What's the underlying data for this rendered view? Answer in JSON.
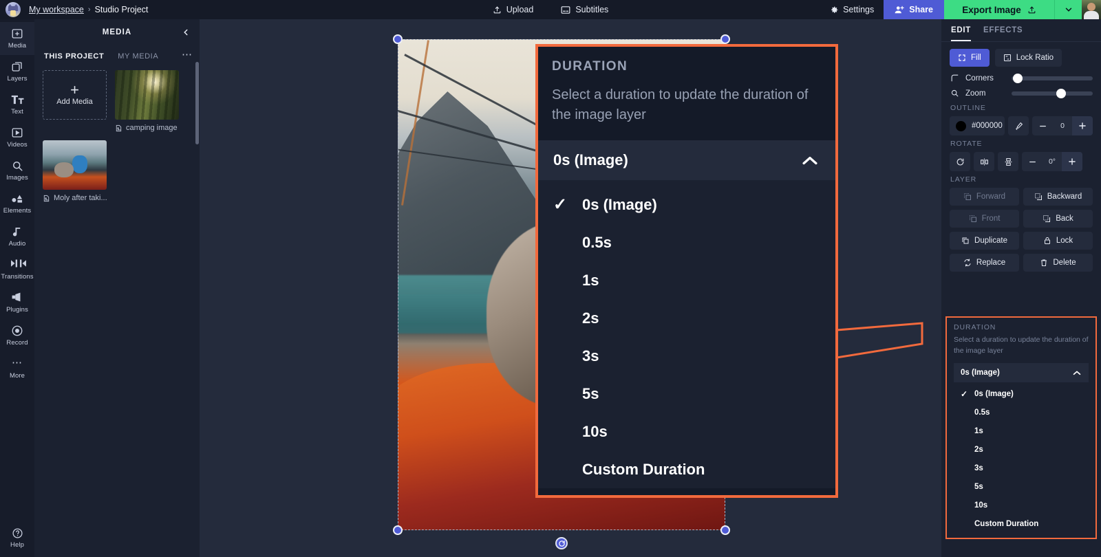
{
  "topbar": {
    "workspace": "My workspace",
    "separator": "›",
    "project": "Studio Project",
    "upload": "Upload",
    "subtitles": "Subtitles",
    "settings": "Settings",
    "share": "Share",
    "export": "Export Image",
    "accent_green": "#3ddc84",
    "accent_blue": "#4f5bd5"
  },
  "rail": {
    "items": [
      {
        "label": "Media",
        "icon": "media-icon",
        "active": true
      },
      {
        "label": "Layers",
        "icon": "layers-icon",
        "active": false
      },
      {
        "label": "Text",
        "icon": "text-icon",
        "active": false
      },
      {
        "label": "Videos",
        "icon": "videos-icon",
        "active": false
      },
      {
        "label": "Images",
        "icon": "images-icon",
        "active": false
      },
      {
        "label": "Elements",
        "icon": "elements-icon",
        "active": false
      },
      {
        "label": "Audio",
        "icon": "audio-icon",
        "active": false
      },
      {
        "label": "Transitions",
        "icon": "transitions-icon",
        "active": false
      },
      {
        "label": "Plugins",
        "icon": "plugins-icon",
        "active": false
      },
      {
        "label": "Record",
        "icon": "record-icon",
        "active": false
      },
      {
        "label": "More",
        "icon": "more-icon",
        "active": false
      }
    ],
    "help": "Help"
  },
  "panel": {
    "title": "MEDIA",
    "tabs": [
      {
        "label": "THIS PROJECT",
        "active": true
      },
      {
        "label": "MY MEDIA",
        "active": false
      }
    ],
    "add_media": "Add Media",
    "add_plus": "+",
    "items": [
      {
        "name": "camping image",
        "thumb": "forest"
      },
      {
        "name": "Moly after taki...",
        "thumb": "tent"
      }
    ]
  },
  "callout": {
    "title": "DURATION",
    "description": "Select a duration to update the duration of the image layer",
    "selected": "0s (Image)",
    "check_glyph": "✓",
    "options": [
      {
        "label": "0s (Image)",
        "checked": true
      },
      {
        "label": "0.5s",
        "checked": false
      },
      {
        "label": "1s",
        "checked": false
      },
      {
        "label": "2s",
        "checked": false
      },
      {
        "label": "3s",
        "checked": false
      },
      {
        "label": "5s",
        "checked": false
      },
      {
        "label": "10s",
        "checked": false
      },
      {
        "label": "Custom Duration",
        "checked": false
      }
    ],
    "border_color": "#f26a3d"
  },
  "right": {
    "tabs": [
      {
        "label": "EDIT",
        "active": true
      },
      {
        "label": "EFFECTS",
        "active": false
      }
    ],
    "fill": "Fill",
    "lock_ratio": "Lock Ratio",
    "corners": "Corners",
    "zoom": "Zoom",
    "corners_percent": 3,
    "zoom_percent": 55,
    "outline_label": "OUTLINE",
    "outline_color": "#000000",
    "outline_value": "0",
    "rotate_label": "ROTATE",
    "rotate_value": "0°",
    "layer_label": "LAYER",
    "layer_buttons": [
      {
        "label": "Forward",
        "disabled": true
      },
      {
        "label": "Backward",
        "disabled": false
      },
      {
        "label": "Front",
        "disabled": true
      },
      {
        "label": "Back",
        "disabled": false
      },
      {
        "label": "Duplicate",
        "disabled": false
      },
      {
        "label": "Lock",
        "disabled": false
      },
      {
        "label": "Replace",
        "disabled": false
      },
      {
        "label": "Delete",
        "disabled": false
      }
    ],
    "duration": {
      "title": "DURATION",
      "description": "Select a duration to update the duration of the image layer",
      "selected": "0s (Image)",
      "check_glyph": "✓",
      "options": [
        {
          "label": "0s (Image)",
          "checked": true
        },
        {
          "label": "0.5s",
          "checked": false
        },
        {
          "label": "1s",
          "checked": false
        },
        {
          "label": "2s",
          "checked": false
        },
        {
          "label": "3s",
          "checked": false
        },
        {
          "label": "5s",
          "checked": false
        },
        {
          "label": "10s",
          "checked": false
        },
        {
          "label": "Custom Duration",
          "checked": false
        }
      ]
    }
  }
}
